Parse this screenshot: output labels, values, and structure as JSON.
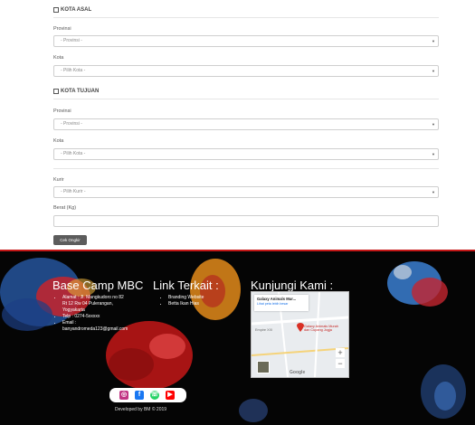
{
  "origin": {
    "heading": "KOTA ASAL",
    "province_label": "Provinsi",
    "province_placeholder": "- Provinsi -",
    "city_label": "Kota",
    "city_placeholder": "- Pilih Kota -"
  },
  "destination": {
    "heading": "KOTA TUJUAN",
    "province_label": "Provinsi",
    "province_placeholder": "- Provinsi -",
    "city_label": "Kota",
    "city_placeholder": "- Pilih Kota -"
  },
  "courier": {
    "label": "Kurir",
    "placeholder": "- Pilih Kurir -"
  },
  "weight": {
    "label": "Berat (Kg)",
    "value": ""
  },
  "check_button": "Cek Ongkir",
  "footer": {
    "col1_title": "Base Camp MBC",
    "address_line": "Alamat : Jl. Mangkudoro no 82",
    "address_line2": "Rt 12 Rw 04 Pulerangan,",
    "address_line3": "Yogyakarta",
    "phone": "Telp : 0274-5xxxxx",
    "email_label": "Email :",
    "email_value": "banyandromeda123@gmail.com",
    "col2_title": "Link Terkait :",
    "links": [
      "Branding Website",
      "Betta Ikan Hias"
    ],
    "col3_title": "Kunjungi Kami :",
    "map": {
      "place_name": "Galaxy Animals Mur...",
      "place_link": "Lihat peta lebih besar",
      "pin_label": "Galaxy Animals Murah dan Cupang Jogja",
      "area_label": "Empire XXI",
      "provider": "Google",
      "zoom_in": "+",
      "zoom_out": "−"
    },
    "developed_by": "Developed by BM © 2019"
  },
  "social_icons": [
    "instagram-icon",
    "facebook-icon",
    "whatsapp-icon",
    "youtube-icon"
  ],
  "colors": {
    "footer_bg": "#050505",
    "footer_accent": "#c41717",
    "button_bg": "#5c5c5c",
    "instagram": "#c13584",
    "facebook": "#1877f2",
    "whatsapp": "#25d366",
    "youtube": "#ff0000"
  }
}
